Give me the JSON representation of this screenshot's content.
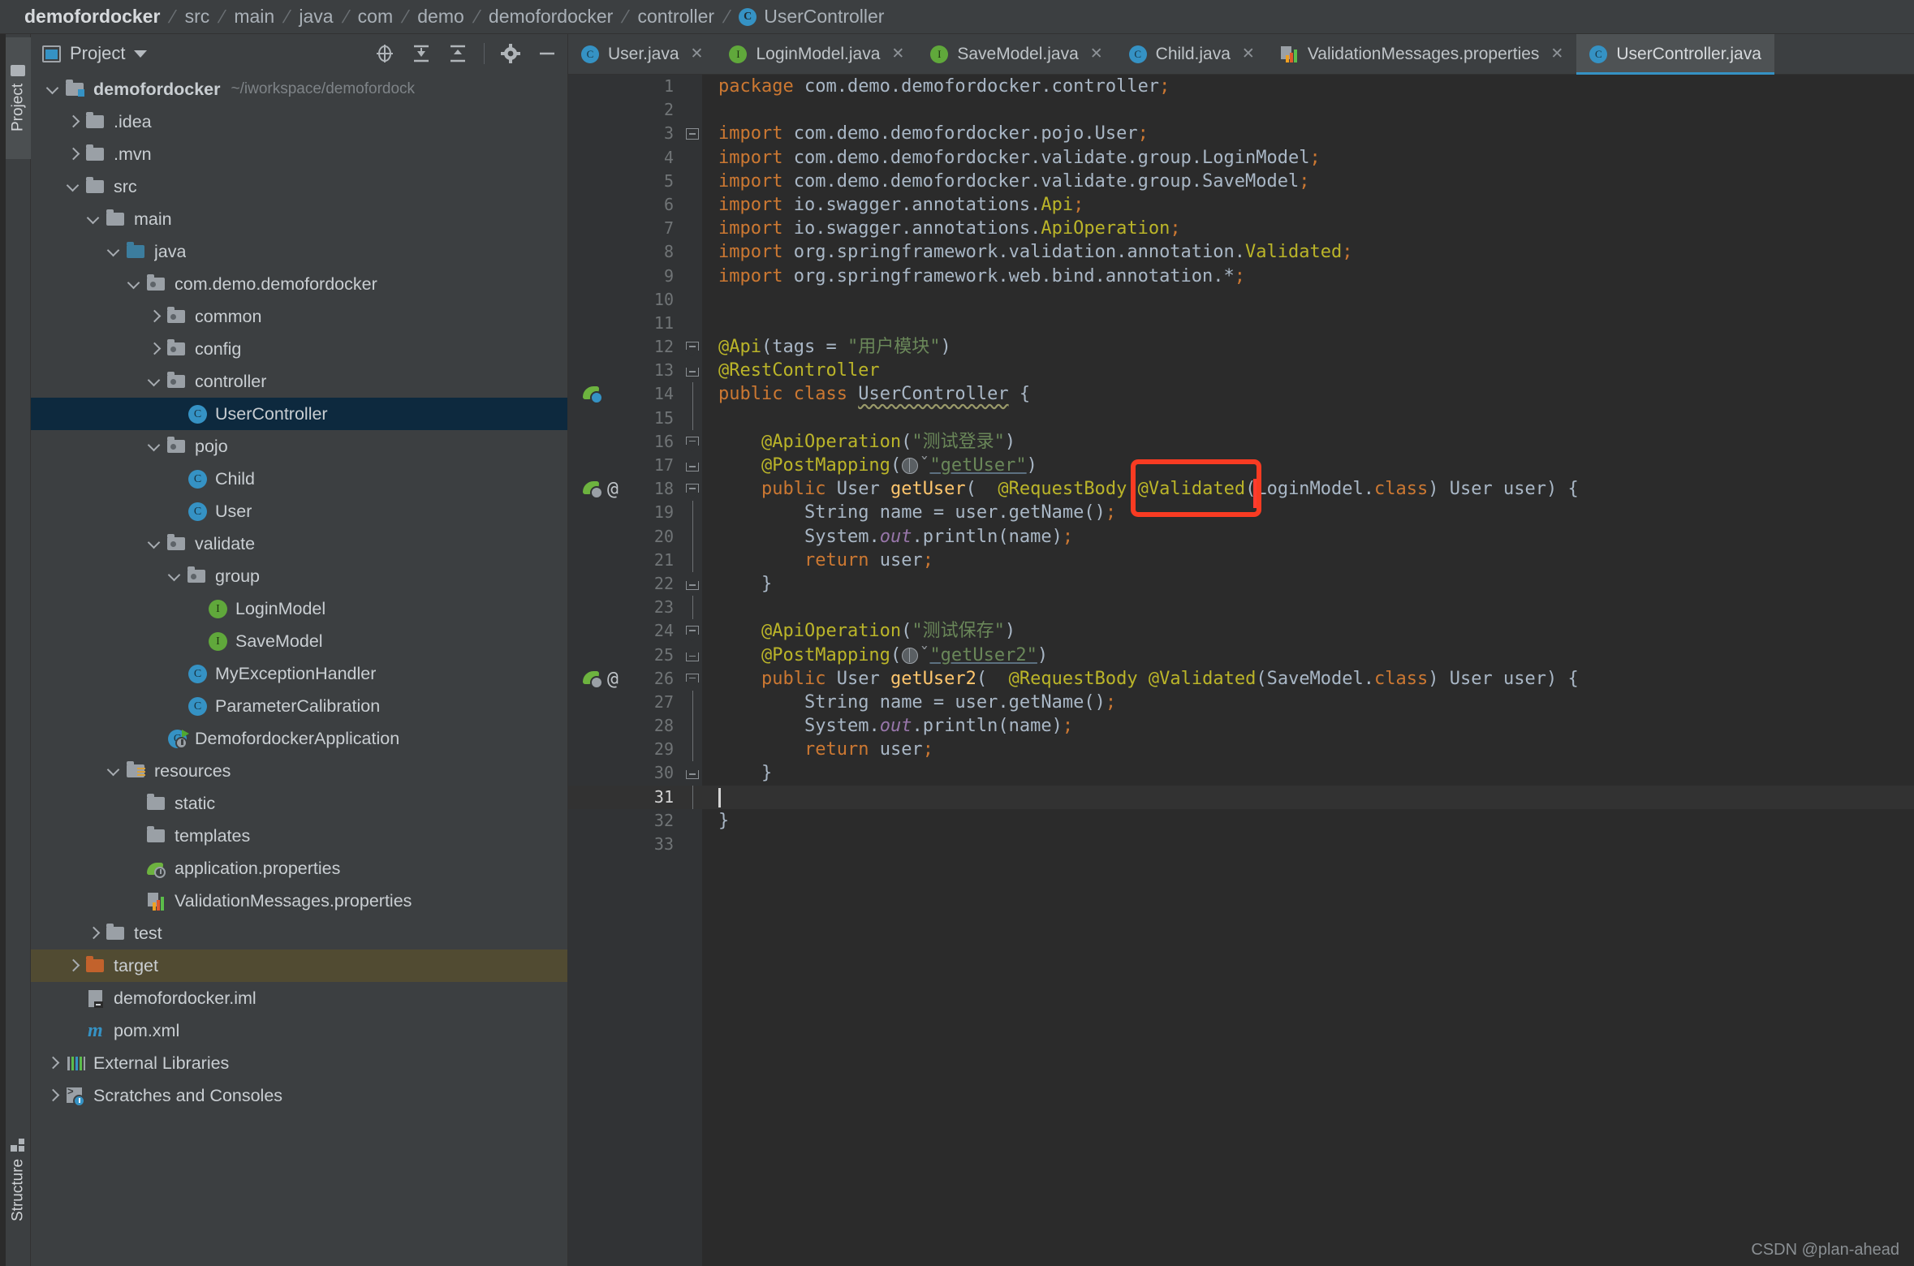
{
  "breadcrumb": {
    "items": [
      {
        "label": "demofordocker",
        "icon": "",
        "root": true
      },
      {
        "label": "src",
        "icon": ""
      },
      {
        "label": "main",
        "icon": ""
      },
      {
        "label": "java",
        "icon": ""
      },
      {
        "label": "com",
        "icon": ""
      },
      {
        "label": "demo",
        "icon": ""
      },
      {
        "label": "demofordocker",
        "icon": ""
      },
      {
        "label": "controller",
        "icon": ""
      },
      {
        "label": "UserController",
        "icon": "class-badge"
      }
    ]
  },
  "left_strip": {
    "project_tab": "Project",
    "structure_tab": "Structure"
  },
  "project_panel": {
    "title": "Project",
    "toolbar_icons": [
      "locate-icon",
      "expand-all-icon",
      "collapse-all-icon",
      "gear-icon",
      "minimize-icon"
    ],
    "tree": [
      {
        "indent": 0,
        "twist": "d",
        "icon": "module-folder",
        "label": "demofordocker",
        "bold": true,
        "sub": "~/iworkspace/demofordock"
      },
      {
        "indent": 1,
        "twist": "r",
        "icon": "folder-grey",
        "label": ".idea"
      },
      {
        "indent": 1,
        "twist": "r",
        "icon": "folder-grey",
        "label": ".mvn"
      },
      {
        "indent": 1,
        "twist": "d",
        "icon": "folder-grey",
        "label": "src"
      },
      {
        "indent": 2,
        "twist": "d",
        "icon": "folder-grey",
        "label": "main"
      },
      {
        "indent": 3,
        "twist": "d",
        "icon": "folder-source",
        "label": "java"
      },
      {
        "indent": 4,
        "twist": "d",
        "icon": "folder-package",
        "label": "com.demo.demofordocker"
      },
      {
        "indent": 5,
        "twist": "r",
        "icon": "folder-package",
        "label": "common"
      },
      {
        "indent": 5,
        "twist": "r",
        "icon": "folder-package",
        "label": "config"
      },
      {
        "indent": 5,
        "twist": "d",
        "icon": "folder-package",
        "label": "controller"
      },
      {
        "indent": 6,
        "twist": "",
        "icon": "class-badge",
        "label": "UserController",
        "state": "selected"
      },
      {
        "indent": 5,
        "twist": "d",
        "icon": "folder-package",
        "label": "pojo"
      },
      {
        "indent": 6,
        "twist": "",
        "icon": "class-badge",
        "label": "Child"
      },
      {
        "indent": 6,
        "twist": "",
        "icon": "class-badge",
        "label": "User"
      },
      {
        "indent": 5,
        "twist": "d",
        "icon": "folder-package",
        "label": "validate"
      },
      {
        "indent": 6,
        "twist": "d",
        "icon": "folder-package",
        "label": "group"
      },
      {
        "indent": 7,
        "twist": "",
        "icon": "interface-badge",
        "label": "LoginModel"
      },
      {
        "indent": 7,
        "twist": "",
        "icon": "interface-badge",
        "label": "SaveModel"
      },
      {
        "indent": 6,
        "twist": "",
        "icon": "class-badge",
        "label": "MyExceptionHandler"
      },
      {
        "indent": 6,
        "twist": "",
        "icon": "class-badge",
        "label": "ParameterCalibration"
      },
      {
        "indent": 5,
        "twist": "",
        "icon": "spring-boot-class",
        "label": "DemofordockerApplication"
      },
      {
        "indent": 3,
        "twist": "d",
        "icon": "folder-resources",
        "label": "resources"
      },
      {
        "indent": 4,
        "twist": "",
        "icon": "folder-grey",
        "label": "static"
      },
      {
        "indent": 4,
        "twist": "",
        "icon": "folder-grey",
        "label": "templates"
      },
      {
        "indent": 4,
        "twist": "",
        "icon": "spring-properties",
        "label": "application.properties"
      },
      {
        "indent": 4,
        "twist": "",
        "icon": "properties-file",
        "label": "ValidationMessages.properties"
      },
      {
        "indent": 2,
        "twist": "r",
        "icon": "folder-grey",
        "label": "test"
      },
      {
        "indent": 1,
        "twist": "r",
        "icon": "folder-excluded",
        "label": "target",
        "state": "hover"
      },
      {
        "indent": 1,
        "twist": "",
        "icon": "iml-file",
        "label": "demofordocker.iml"
      },
      {
        "indent": 1,
        "twist": "",
        "icon": "maven-file",
        "label": "pom.xml"
      },
      {
        "indent": 0,
        "twist": "r",
        "icon": "external-libraries",
        "label": "External Libraries"
      },
      {
        "indent": 0,
        "twist": "r",
        "icon": "scratches",
        "label": "Scratches and Consoles"
      }
    ]
  },
  "editor": {
    "tabs": [
      {
        "label": "User.java",
        "icon": "class-badge",
        "active": false,
        "closable": true
      },
      {
        "label": "LoginModel.java",
        "icon": "interface-badge",
        "active": false,
        "closable": true
      },
      {
        "label": "SaveModel.java",
        "icon": "interface-badge",
        "active": false,
        "closable": true
      },
      {
        "label": "Child.java",
        "icon": "class-badge",
        "active": false,
        "closable": true
      },
      {
        "label": "ValidationMessages.properties",
        "icon": "properties-file",
        "active": false,
        "closable": true
      },
      {
        "label": "UserController.java",
        "icon": "class-badge",
        "active": true,
        "closable": false
      }
    ],
    "file_name": "UserController.java",
    "caret_line": 31,
    "lines": [
      {
        "n": 1,
        "text": "package com.demo.demofordocker.controller;"
      },
      {
        "n": 2,
        "text": ""
      },
      {
        "n": 3,
        "text": "import com.demo.demofordocker.pojo.User;"
      },
      {
        "n": 4,
        "text": "import com.demo.demofordocker.validate.group.LoginModel;"
      },
      {
        "n": 5,
        "text": "import com.demo.demofordocker.validate.group.SaveModel;"
      },
      {
        "n": 6,
        "text": "import io.swagger.annotations.Api;"
      },
      {
        "n": 7,
        "text": "import io.swagger.annotations.ApiOperation;"
      },
      {
        "n": 8,
        "text": "import org.springframework.validation.annotation.Validated;"
      },
      {
        "n": 9,
        "text": "import org.springframework.web.bind.annotation.*;"
      },
      {
        "n": 10,
        "text": ""
      },
      {
        "n": 11,
        "text": ""
      },
      {
        "n": 12,
        "text": "@Api(tags = \"用户模块\")"
      },
      {
        "n": 13,
        "text": "@RestController"
      },
      {
        "n": 14,
        "text": "public class UserController {"
      },
      {
        "n": 15,
        "text": ""
      },
      {
        "n": 16,
        "text": "    @ApiOperation(\"测试登录\")"
      },
      {
        "n": 17,
        "text": "    @PostMapping(\"getUser\")"
      },
      {
        "n": 18,
        "text": "    public User getUser(  @RequestBody @Validated(LoginModel.class) User user) {"
      },
      {
        "n": 19,
        "text": "        String name = user.getName();"
      },
      {
        "n": 20,
        "text": "        System.out.println(name);"
      },
      {
        "n": 21,
        "text": "        return user;"
      },
      {
        "n": 22,
        "text": "    }"
      },
      {
        "n": 23,
        "text": ""
      },
      {
        "n": 24,
        "text": "    @ApiOperation(\"测试保存\")"
      },
      {
        "n": 25,
        "text": "    @PostMapping(\"getUser2\")"
      },
      {
        "n": 26,
        "text": "    public User getUser2(  @RequestBody @Validated(SaveModel.class) User user) {"
      },
      {
        "n": 27,
        "text": "        String name = user.getName();"
      },
      {
        "n": 28,
        "text": "        System.out.println(name);"
      },
      {
        "n": 29,
        "text": "        return user;"
      },
      {
        "n": 30,
        "text": "    }"
      },
      {
        "n": 31,
        "text": ""
      },
      {
        "n": 32,
        "text": "}"
      },
      {
        "n": 33,
        "text": ""
      }
    ],
    "annotation": {
      "shape": "rectangle",
      "color": "#f93b22",
      "target_text": "@Validated("
    }
  },
  "watermark": "CSDN @plan-ahead",
  "colors": {
    "accent": "#3592c4",
    "selection": "#0d293e",
    "hover": "#514b32",
    "editor_bg": "#2b2b2b",
    "panel_bg": "#3c3f41",
    "annotation_red": "#f93b22",
    "keyword": "#cc7832",
    "string": "#6a8759",
    "annotation_yellow": "#bbb529",
    "method": "#ffc66d",
    "field": "#9876aa"
  }
}
